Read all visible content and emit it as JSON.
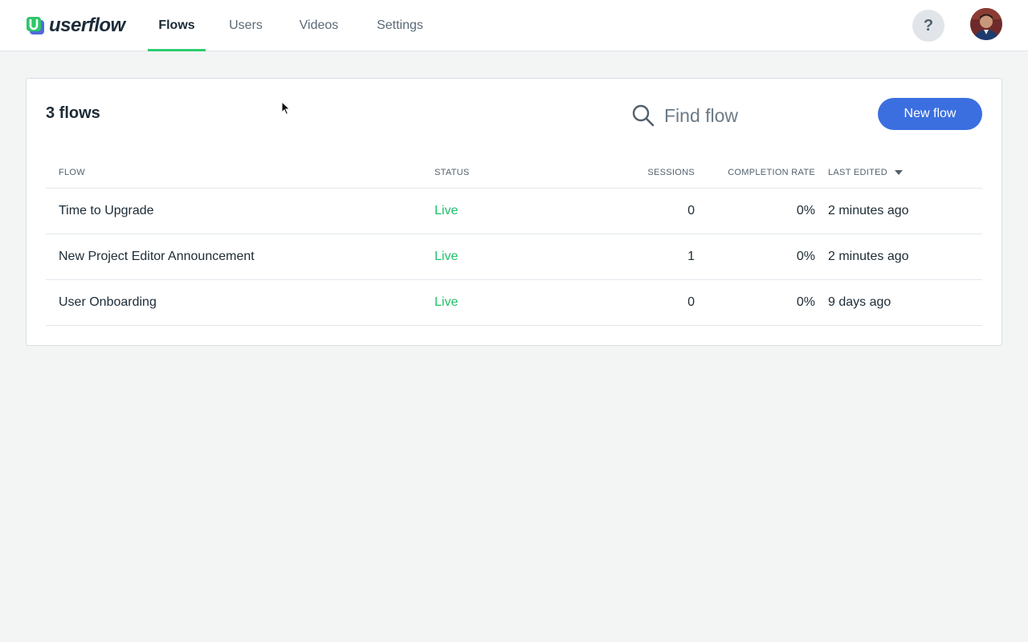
{
  "brand": {
    "name": "userflow"
  },
  "nav": {
    "tabs": [
      {
        "label": "Flows",
        "active": true
      },
      {
        "label": "Users",
        "active": false
      },
      {
        "label": "Videos",
        "active": false
      },
      {
        "label": "Settings",
        "active": false
      }
    ]
  },
  "header": {
    "help_label": "?"
  },
  "main": {
    "title": "3 flows",
    "search": {
      "placeholder": "Find flow",
      "value": ""
    },
    "new_button": "New flow",
    "table": {
      "columns": [
        "Flow",
        "Status",
        "Sessions",
        "Completion rate",
        "Last edited"
      ],
      "sort_column": "Last edited",
      "rows": [
        {
          "flow": "Time to Upgrade",
          "status": "Live",
          "sessions": "0",
          "completion_rate": "0%",
          "last_edited": "2 minutes ago"
        },
        {
          "flow": "New Project Editor Announcement",
          "status": "Live",
          "sessions": "1",
          "completion_rate": "0%",
          "last_edited": "2 minutes ago"
        },
        {
          "flow": "User Onboarding",
          "status": "Live",
          "sessions": "0",
          "completion_rate": "0%",
          "last_edited": "9 days ago"
        }
      ]
    }
  },
  "colors": {
    "accent": "#3b6fe0",
    "live": "#21c06b",
    "active_tab_underline": "#2ecc71",
    "background": "#f3f5f5"
  },
  "icons": [
    "logo-icon",
    "help-icon",
    "avatar",
    "search-icon",
    "sort-desc-icon",
    "mouse-cursor"
  ]
}
